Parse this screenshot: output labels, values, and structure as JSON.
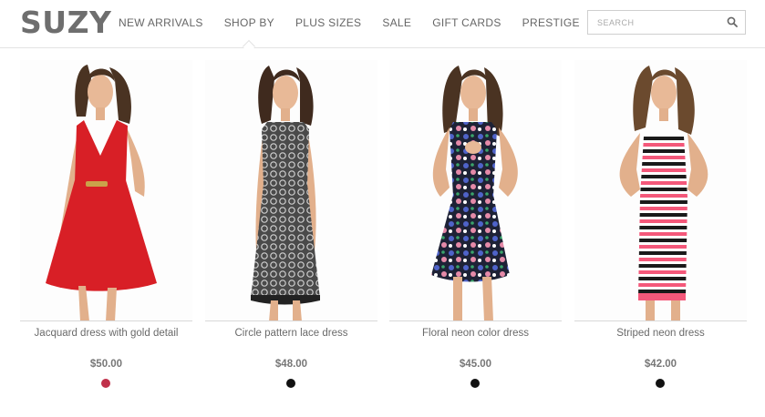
{
  "brand": {
    "logo": "SUZY"
  },
  "nav": {
    "items": [
      {
        "label": "NEW ARRIVALS"
      },
      {
        "label": "SHOP BY"
      },
      {
        "label": "PLUS SIZES"
      },
      {
        "label": "SALE"
      },
      {
        "label": "GIFT CARDS"
      },
      {
        "label": "PRESTIGE"
      }
    ],
    "active": "SHOP BY"
  },
  "search": {
    "placeholder": "SEARCH",
    "icon": "search-icon"
  },
  "products": [
    {
      "name": "Jacquard dress with gold detail",
      "price": "$50.00",
      "swatch_color": "#c0304a",
      "dress_color": "#d81f26",
      "pattern": "solid"
    },
    {
      "name": "Circle pattern lace dress",
      "price": "$48.00",
      "swatch_color": "#111111",
      "dress_color": "#3b3b3b",
      "pattern": "lace"
    },
    {
      "name": "Floral neon color dress",
      "price": "$45.00",
      "swatch_color": "#111111",
      "dress_color": "#1f2233",
      "pattern": "floral"
    },
    {
      "name": "Striped neon dress",
      "price": "$42.00",
      "swatch_color": "#111111",
      "dress_color": "#ffffff",
      "pattern": "stripes"
    }
  ]
}
